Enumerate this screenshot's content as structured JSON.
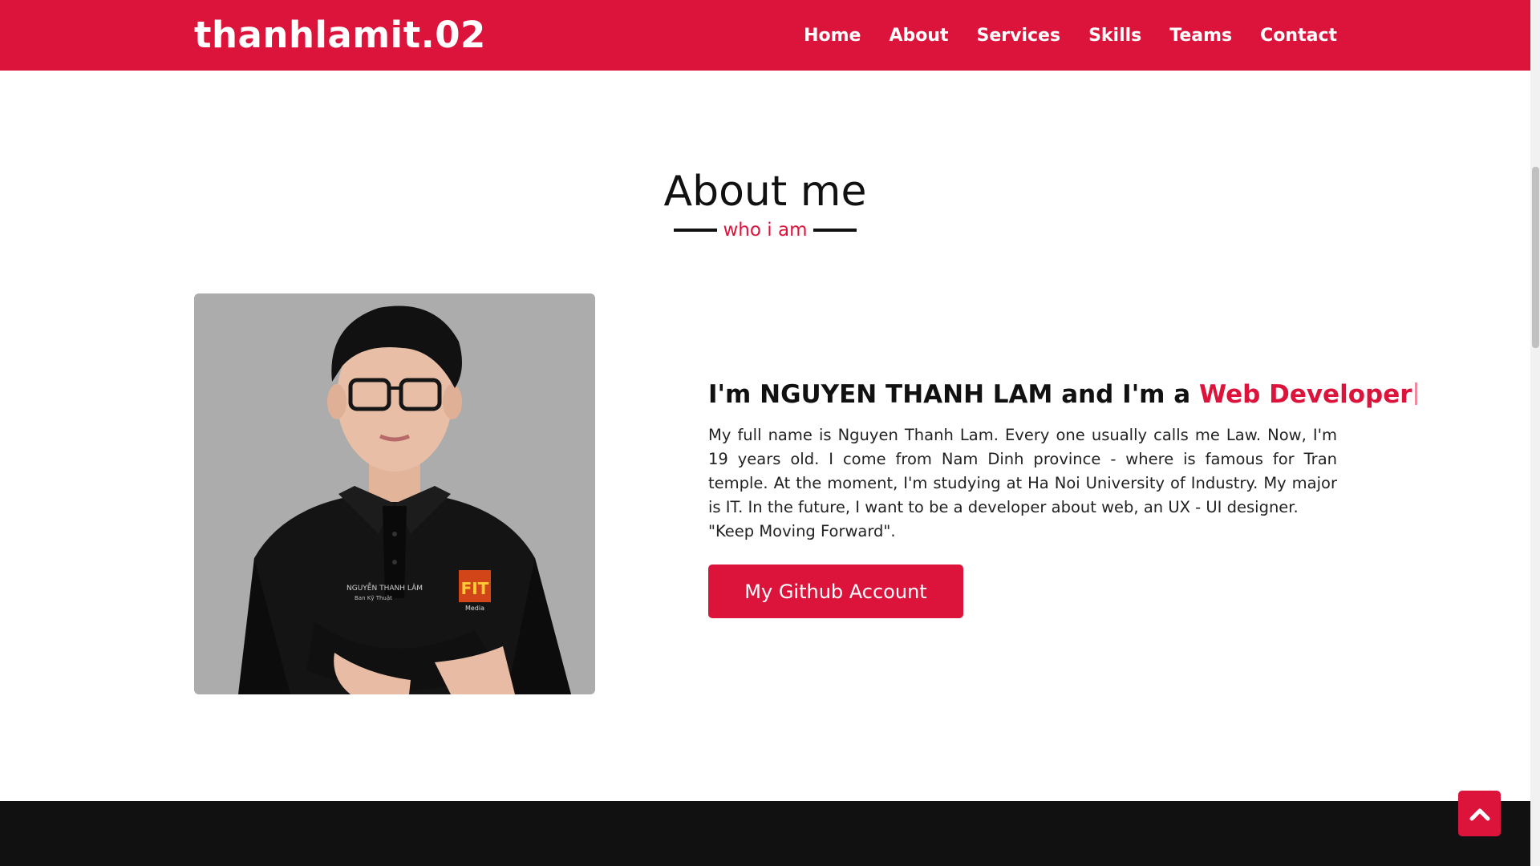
{
  "navbar": {
    "logo": "thanhlamit.02",
    "links": [
      "Home",
      "About",
      "Services",
      "Skills",
      "Teams",
      "Contact"
    ]
  },
  "about": {
    "title": "About me",
    "subtitle": "who i am",
    "heading_prefix": "I'm NGUYEN THANH LAM and I'm a ",
    "role": "Web Developer",
    "description": "My full name is Nguyen Thanh Lam. Every one usually calls me Law. Now, I'm 19 years old. I come from Nam Dinh province - where is famous for Tran temple. At the moment, I'm studying at Ha Noi University of Industry. My major is IT. In the future, I want to be a developer about web, an UX - UI designer.",
    "quote": "\"Keep Moving Forward\".",
    "button_label": "My Github Account",
    "shirt_name": "NGUYỄN THANH LÂM",
    "shirt_tag": "Ban Kỹ Thuật",
    "shirt_logo": "FIT",
    "shirt_logo_sub": "Media"
  },
  "colors": {
    "accent": "#dc143c",
    "dark": "#111111",
    "photo_bg": "#acacac"
  },
  "icons": {
    "back_to_top": "chevron-up-icon"
  }
}
